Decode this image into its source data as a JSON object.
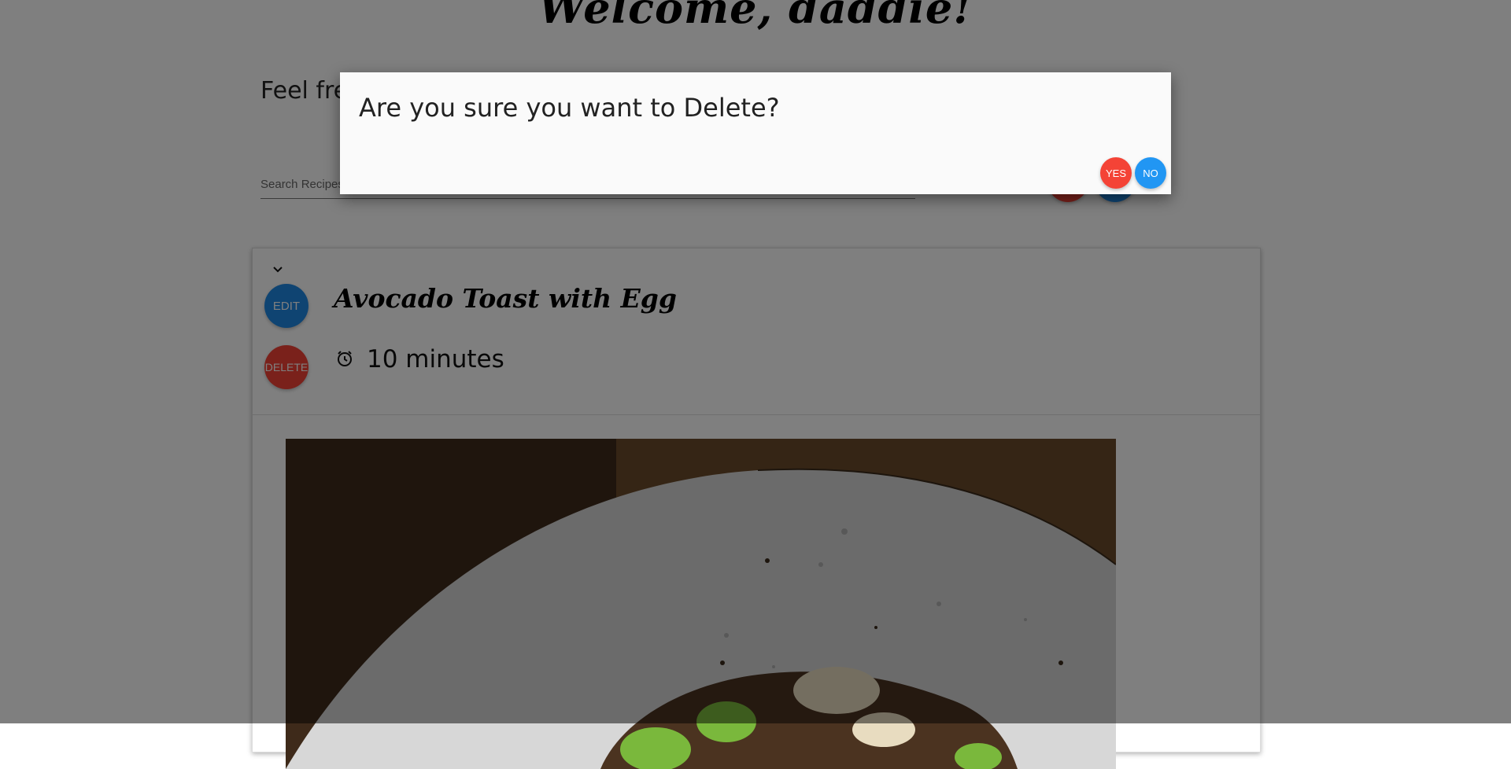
{
  "header": {
    "welcome": "Welcome, daddie!",
    "subtitle": "Feel fre"
  },
  "search": {
    "placeholder": "Search Recipes"
  },
  "recipe": {
    "title": "Avocado Toast with Egg",
    "time": "10 minutes",
    "edit_label": "EDIT",
    "delete_label": "DELETE"
  },
  "dialog": {
    "message": "Are you sure you want to Delete?",
    "yes_label": "YES",
    "no_label": "NO"
  },
  "icons": {
    "expand": "chevron-down-icon",
    "time": "alarm-clock-icon"
  },
  "colors": {
    "danger": "#f44336",
    "primary": "#1e88e5",
    "overlay": "rgba(0,0,0,0.5)"
  }
}
